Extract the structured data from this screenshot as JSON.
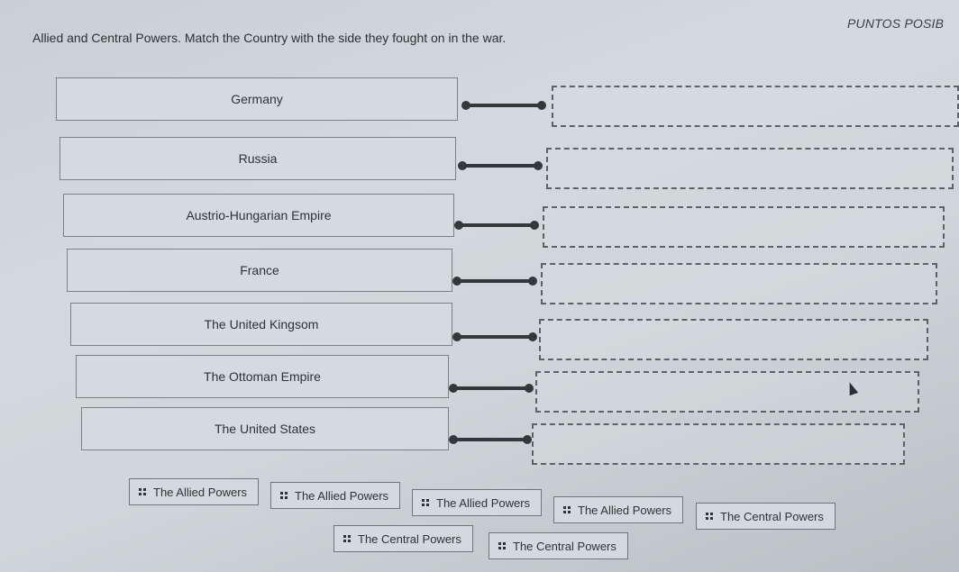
{
  "header": {
    "instructions": "Allied and Central Powers. Match the Country with the side they fought on in the war.",
    "points_label": "PUNTOS POSIB"
  },
  "matching": {
    "countries": [
      {
        "label": "Germany",
        "answer": ""
      },
      {
        "label": "Russia",
        "answer": ""
      },
      {
        "label": "Austrio-Hungarian Empire",
        "answer": ""
      },
      {
        "label": "France",
        "answer": ""
      },
      {
        "label": "The United Kingsom",
        "answer": ""
      },
      {
        "label": "The Ottoman Empire",
        "answer": ""
      },
      {
        "label": "The United States",
        "answer": ""
      }
    ]
  },
  "answer_bank": {
    "options": [
      {
        "label": "The Allied Powers",
        "icon": "drag-handle-icon"
      },
      {
        "label": "The Allied Powers",
        "icon": "drag-handle-icon"
      },
      {
        "label": "The Allied Powers",
        "icon": "drag-handle-icon"
      },
      {
        "label": "The Allied Powers",
        "icon": "drag-handle-icon"
      },
      {
        "label": "The Central Powers",
        "icon": "drag-handle-icon"
      },
      {
        "label": "The Central Powers",
        "icon": "drag-handle-icon"
      },
      {
        "label": "The Central Powers",
        "icon": "drag-handle-icon"
      }
    ]
  },
  "colors": {
    "background": "#cfd6d9",
    "box_border": "#7b8286",
    "connector": "#34383b",
    "dashed_border": "#5c6266"
  }
}
